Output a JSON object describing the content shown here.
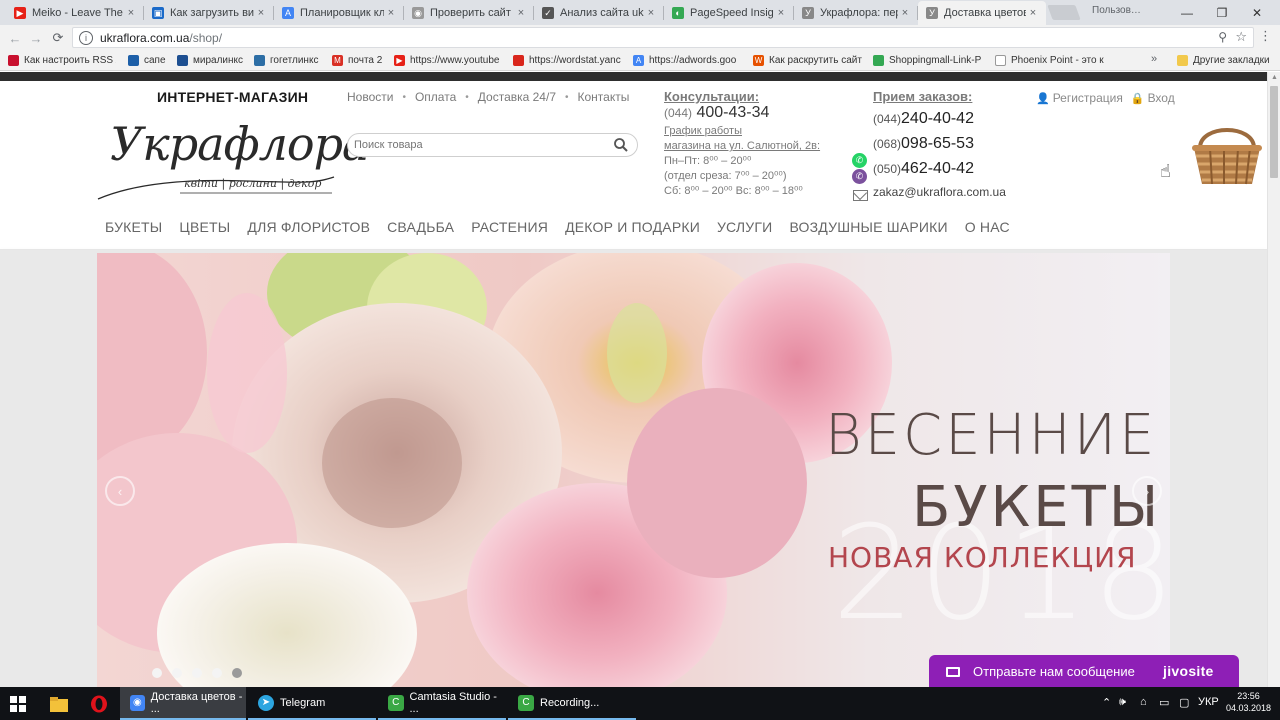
{
  "browser": {
    "tabs": [
      {
        "label": "Meiko - Leave The",
        "color": "#e62117",
        "glyph": "▶"
      },
      {
        "label": "Как загрузить вид",
        "color": "#1b6ac9",
        "glyph": "▣"
      },
      {
        "label": "Планировщик кл",
        "color": "#4285f4",
        "glyph": "A"
      },
      {
        "label": "Проверить сайт н",
        "color": "#999999",
        "glyph": "◉"
      },
      {
        "label": "Анализ сайта ukra",
        "color": "#555555",
        "glyph": "✓"
      },
      {
        "label": "PageSpeed Insight",
        "color": "#34a853",
        "glyph": "◐"
      },
      {
        "label": "Укрaфлора: пере",
        "color": "#888888",
        "glyph": "У"
      },
      {
        "label": "Доставка цветов",
        "color": "#888888",
        "glyph": "У"
      }
    ],
    "close_glyph": "×",
    "user_chip": "Пользов…",
    "window_controls": {
      "minimize": "—",
      "restore": "❐",
      "close": "✕"
    },
    "nav": {
      "back": "←",
      "forward": "→",
      "reload": "⟳"
    },
    "address": {
      "info": "i",
      "domain": "ukraflora.com.ua",
      "path": "/shop/"
    },
    "zoom_glyph": "⚲",
    "star_glyph": "☆",
    "menu_glyph": "⋮",
    "bookmarks": [
      {
        "label": "Как настроить RSS л",
        "color": "#c8102e"
      },
      {
        "label": "сапе",
        "color": "#1d5fa8"
      },
      {
        "label": "миралинкс",
        "color": "#1d4f91"
      },
      {
        "label": "гогетлинкс",
        "color": "#2d6ea5"
      },
      {
        "label": "почта 2",
        "color": "#d93025"
      },
      {
        "label": "https://www.youtube",
        "color": "#e62117"
      },
      {
        "label": "https://wordstat.yanc",
        "color": "#d9261c"
      },
      {
        "label": "https://adwords.goo",
        "color": "#4285f4"
      },
      {
        "label": "Как раскрутить сайт",
        "color": "#e65100"
      },
      {
        "label": "Shoppingmall-Link-P",
        "color": "#34a853"
      },
      {
        "label": "Phoenix Point - это к",
        "color": "#666666"
      }
    ],
    "bookmarks_more": "»",
    "other_bookmarks": "Другие закладки"
  },
  "site": {
    "shop_label": "ИНТЕРНЕТ-МАГАЗИН",
    "logo_script": "Укрaфлора",
    "logo_tagline": "квіти | рослини | декор",
    "topnav": [
      "Новости",
      "Оплата",
      "Доставка 24/7",
      "Контакты"
    ],
    "topnav_sep": "•",
    "search_placeholder": "Поиск товара",
    "consult": {
      "heading": "Консультации:",
      "phone_code": "(044)",
      "phone": "400-43-34",
      "schedule_link1": "График работы",
      "schedule_link2": "магазина на ул. Салютной, 2в:",
      "line1": "Пн–Пт: 8⁰⁰ – 20⁰⁰",
      "line2": "(отдел среза: 7⁰⁰ – 20⁰⁰)",
      "line3": "Сб: 8⁰⁰ – 20⁰⁰ Вс: 8⁰⁰ – 18⁰⁰"
    },
    "orders": {
      "heading": "Прием заказов:",
      "phones": [
        {
          "code": "(044)",
          "number": "240-40-42"
        },
        {
          "code": "(068)",
          "number": "098-65-53"
        },
        {
          "code": "(050)",
          "number": "462-40-42"
        }
      ],
      "email": "zakaz@ukraflora.com.ua"
    },
    "auth": {
      "register": "Регистрация",
      "login": "Вход"
    },
    "mainnav": [
      "БУКЕТЫ",
      "ЦВЕТЫ",
      "ДЛЯ ФЛОРИСТОВ",
      "СВАДЬБА",
      "РАСТЕНИЯ",
      "ДЕКОР И ПОДАРКИ",
      "УСЛУГИ",
      "ВОЗДУШНЫЕ ШАРИКИ",
      "О НАС"
    ],
    "banner": {
      "title1": "ВЕСЕННИЕ",
      "title2": "БУКЕТЫ",
      "subtitle": "НОВАЯ КОЛЛЕКЦИЯ",
      "year": "2018",
      "prev": "‹",
      "next": "›",
      "slides": 5,
      "active_slide": 5
    },
    "chat": {
      "text": "Отправьте нам сообщение",
      "brand": "jivosite"
    }
  },
  "taskbar": {
    "apps": [
      {
        "label": "Доставка цветов - ...",
        "color": "#4285f4",
        "glyph": "◉"
      },
      {
        "label": "Telegram",
        "color": "#2ca5e0",
        "glyph": "➤"
      },
      {
        "label": "Camtasia Studio - ...",
        "color": "#3aa845",
        "glyph": "C"
      },
      {
        "label": "Recording...",
        "color": "#3aa845",
        "glyph": "C"
      }
    ],
    "tray": {
      "chevron": "⌃",
      "volume": "🕪",
      "lang": "УКР"
    },
    "clock": {
      "time": "23:56",
      "date": "04.03.2018"
    }
  }
}
